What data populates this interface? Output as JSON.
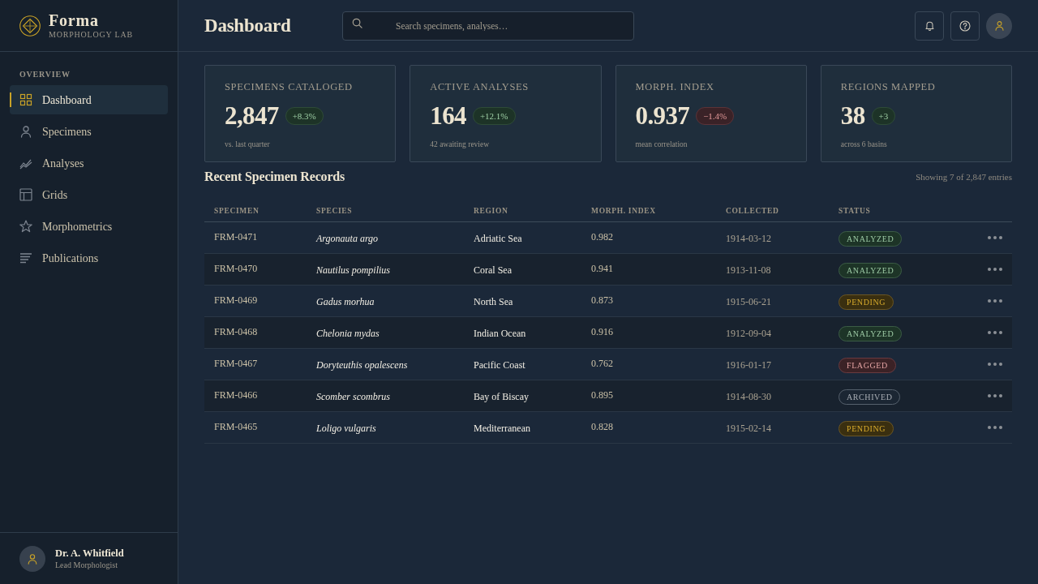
{
  "brand": {
    "name": "Forma",
    "subtitle": "MORPHOLOGY LAB"
  },
  "sidebar": {
    "section": "OVERVIEW",
    "items": [
      {
        "label": "Dashboard",
        "selected": true
      },
      {
        "label": "Specimens",
        "selected": false
      },
      {
        "label": "Analyses",
        "selected": false
      },
      {
        "label": "Grids",
        "selected": false
      },
      {
        "label": "Morphometrics",
        "selected": false
      },
      {
        "label": "Publications",
        "selected": false
      }
    ],
    "user": {
      "name": "Dr. A. Whitfield",
      "role": "Lead Morphologist"
    }
  },
  "header": {
    "title": "Dashboard",
    "search": {
      "placeholder": "Search specimens, analyses…"
    }
  },
  "stats": [
    {
      "label": "SPECIMENS CATALOGED",
      "value": "2,847",
      "delta": "+8.3%",
      "negative": false,
      "note": "vs. last quarter"
    },
    {
      "label": "ACTIVE ANALYSES",
      "value": "164",
      "delta": "+12.1%",
      "negative": false,
      "note": "42 awaiting review"
    },
    {
      "label": "MORPH. INDEX",
      "value": "0.937",
      "delta": "−1.4%",
      "negative": true,
      "note": "mean correlation"
    },
    {
      "label": "REGIONS MAPPED",
      "value": "38",
      "delta": "+3",
      "negative": false,
      "note": "across 6 basins"
    }
  ],
  "table": {
    "title": "Recent Specimen Records",
    "summary": "Showing 7 of 2,847 entries",
    "columns": [
      "SPECIMEN",
      "SPECIES",
      "REGION",
      "MORPH. INDEX",
      "COLLECTED",
      "STATUS"
    ],
    "rows": [
      {
        "specimen": "FRM-0471",
        "species": "Argonauta argo",
        "region": "Adriatic Sea",
        "index": "0.982",
        "collected": "1914-03-12",
        "status": "ANALYZED",
        "kind": "analyzed"
      },
      {
        "specimen": "FRM-0470",
        "species": "Nautilus pompilius",
        "region": "Coral Sea",
        "index": "0.941",
        "collected": "1913-11-08",
        "status": "ANALYZED",
        "kind": "analyzed"
      },
      {
        "specimen": "FRM-0469",
        "species": "Gadus morhua",
        "region": "North Sea",
        "index": "0.873",
        "collected": "1915-06-21",
        "status": "PENDING",
        "kind": "pending"
      },
      {
        "specimen": "FRM-0468",
        "species": "Chelonia mydas",
        "region": "Indian Ocean",
        "index": "0.916",
        "collected": "1912-09-04",
        "status": "ANALYZED",
        "kind": "analyzed"
      },
      {
        "specimen": "FRM-0467",
        "species": "Doryteuthis opalescens",
        "region": "Pacific Coast",
        "index": "0.762",
        "collected": "1916-01-17",
        "status": "FLAGGED",
        "kind": "flagged"
      },
      {
        "specimen": "FRM-0466",
        "species": "Scomber scombrus",
        "region": "Bay of Biscay",
        "index": "0.895",
        "collected": "1914-08-30",
        "status": "ARCHIVED",
        "kind": "archived"
      },
      {
        "specimen": "FRM-0465",
        "species": "Loligo vulgaris",
        "region": "Mediterranean",
        "index": "0.828",
        "collected": "1915-02-14",
        "status": "PENDING",
        "kind": "pending"
      }
    ]
  }
}
